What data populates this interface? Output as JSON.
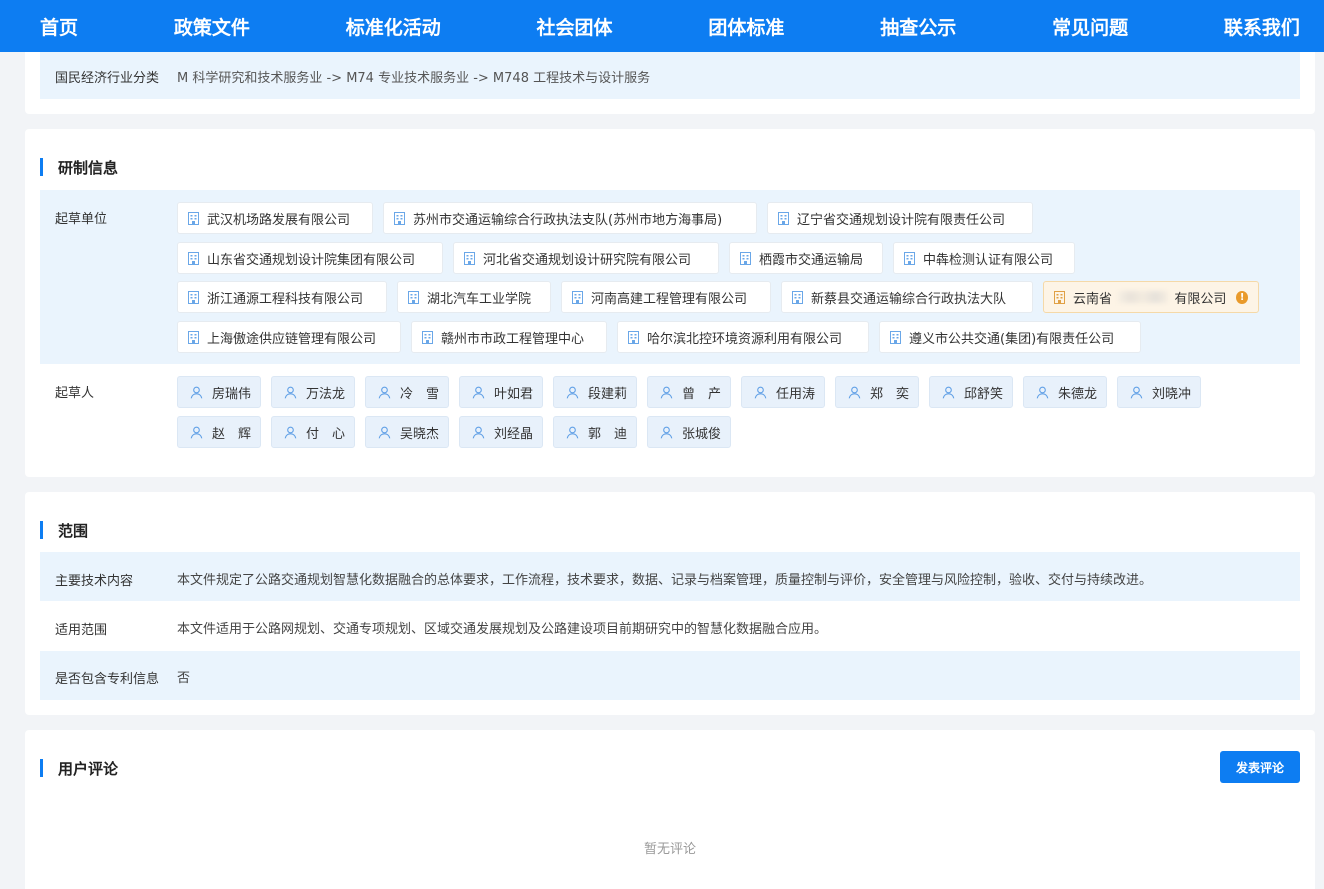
{
  "nav": [
    "首页",
    "政策文件",
    "标准化活动",
    "社会团体",
    "团体标准",
    "抽查公示",
    "常见问题",
    "联系我们"
  ],
  "industry": {
    "label": "国民经济行业分类",
    "value": "M 科学研究和技术服务业 -> M74 专业技术服务业 -> M748 工程技术与设计服务"
  },
  "development": {
    "title": "研制信息",
    "drafting_units_label": "起草单位",
    "drafting_units": [
      "武汉机场路发展有限公司",
      "苏州市交通运输综合行政执法支队(苏州市地方海事局)",
      "辽宁省交通规划设计院有限责任公司",
      "山东省交通规划设计院集团有限公司",
      "河北省交通规划设计研究院有限公司",
      "栖霞市交通运输局",
      "中犇检测认证有限公司",
      "浙江通源工程科技有限公司",
      "湖北汽车工业学院",
      "河南高建工程管理有限公司",
      "新蔡县交通运输综合行政执法大队",
      "上海傲途供应链管理有限公司",
      "赣州市市政工程管理中心",
      "哈尔滨北控环境资源利用有限公司",
      "遵义市公共交通(集团)有限责任公司"
    ],
    "warned_unit": {
      "prefix": "云南省",
      "suffix": "有限公司",
      "warn_icon": "warning-icon",
      "color": "#e99a2b"
    },
    "drafters_label": "起草人",
    "drafters": [
      "房瑞伟",
      "万法龙",
      "冷　雪",
      "叶如君",
      "段建莉",
      "曾　产",
      "任用涛",
      "郑　奕",
      "邱舒笑",
      "朱德龙",
      "刘晓冲",
      "赵　辉",
      "付　心",
      "吴晓杰",
      "刘经晶",
      "郭　迪",
      "张城俊"
    ]
  },
  "scope": {
    "title": "范围",
    "rows": [
      {
        "label": "主要技术内容",
        "value": "本文件规定了公路交通规划智慧化数据融合的总体要求，工作流程，技术要求，数据、记录与档案管理，质量控制与评价，安全管理与风险控制，验收、交付与持续改进。"
      },
      {
        "label": "适用范围",
        "value": "本文件适用于公路网规划、交通专项规划、区域交通发展规划及公路建设项目前期研究中的智慧化数据融合应用。"
      },
      {
        "label": "是否包含专利信息",
        "value": "否"
      }
    ]
  },
  "comments": {
    "title": "用户评论",
    "post_button": "发表评论",
    "empty": "暂无评论"
  },
  "colors": {
    "brand": "#0d7df2",
    "band": "#eaf4fd",
    "warn": "#e99a2b"
  }
}
